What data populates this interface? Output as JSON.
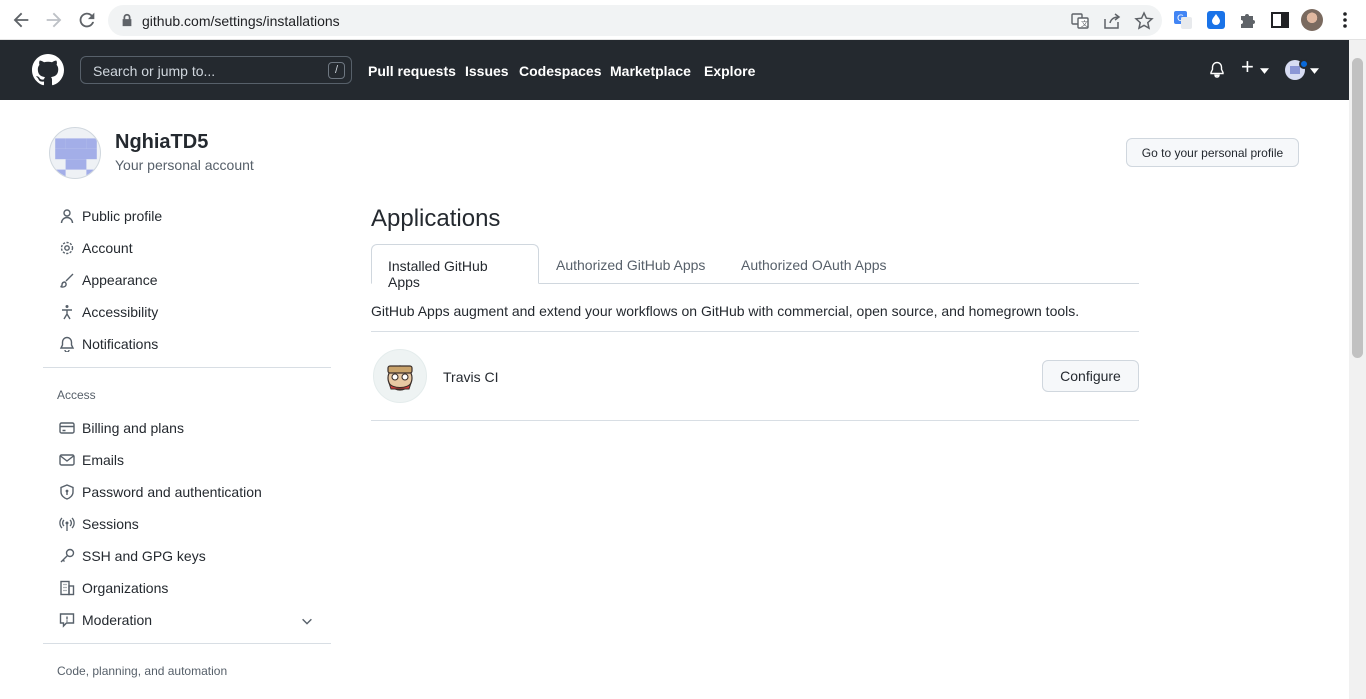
{
  "browser": {
    "url": "github.com/settings/installations"
  },
  "header": {
    "search_placeholder": "Search or jump to...",
    "search_shortcut": "/",
    "nav": [
      "Pull requests",
      "Issues",
      "Codespaces",
      "Marketplace",
      "Explore"
    ],
    "plus_label": "+"
  },
  "profile": {
    "name": "NghiaTD5",
    "subtitle": "Your personal account",
    "profile_button": "Go to your personal profile"
  },
  "sidebar": {
    "items": [
      {
        "label": "Public profile",
        "icon": "person-icon"
      },
      {
        "label": "Account",
        "icon": "gear-icon"
      },
      {
        "label": "Appearance",
        "icon": "paintbrush-icon"
      },
      {
        "label": "Accessibility",
        "icon": "accessibility-icon"
      },
      {
        "label": "Notifications",
        "icon": "bell-icon"
      }
    ],
    "access_heading": "Access",
    "access_items": [
      {
        "label": "Billing and plans",
        "icon": "credit-card-icon"
      },
      {
        "label": "Emails",
        "icon": "mail-icon"
      },
      {
        "label": "Password and authentication",
        "icon": "shield-lock-icon"
      },
      {
        "label": "Sessions",
        "icon": "broadcast-icon"
      },
      {
        "label": "SSH and GPG keys",
        "icon": "key-icon"
      },
      {
        "label": "Organizations",
        "icon": "organization-icon"
      },
      {
        "label": "Moderation",
        "icon": "report-icon"
      }
    ],
    "code_heading": "Code, planning, and automation"
  },
  "main": {
    "title": "Applications",
    "tabs": [
      "Installed GitHub Apps",
      "Authorized GitHub Apps",
      "Authorized OAuth Apps"
    ],
    "active_tab": 0,
    "description": "GitHub Apps augment and extend your workflows on GitHub with commercial, open source, and homegrown tools.",
    "apps": [
      {
        "name": "Travis CI",
        "action": "Configure"
      }
    ]
  },
  "colors": {
    "header_bg": "#24292f",
    "accent_blue": "#0969da"
  }
}
